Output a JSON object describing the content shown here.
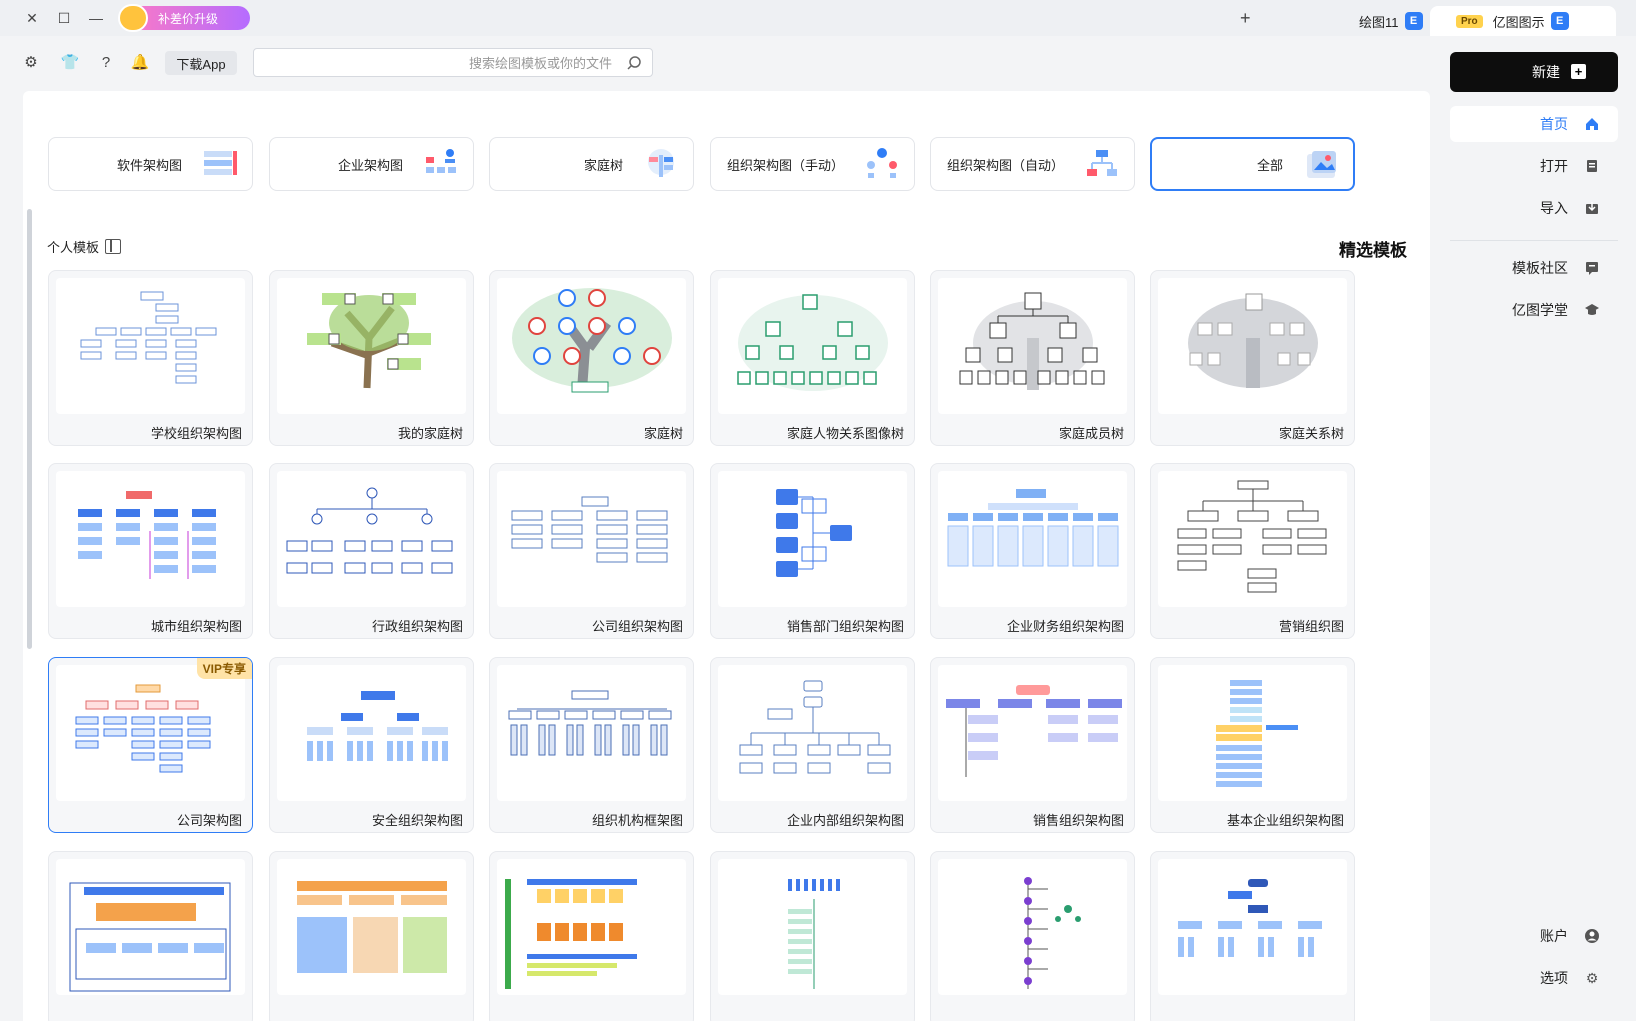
{
  "titlebar": {
    "promo_label": "补差价升级",
    "doc_tab": "绘图11",
    "home_tab": "亿图图示",
    "pro_badge": "Pro",
    "app_badge": "E"
  },
  "toolbar": {
    "download_label": "下载App",
    "search_placeholder": "搜索绘图模板或你的文件"
  },
  "categories": [
    {
      "label": "全部",
      "active": true
    },
    {
      "label": "组织架构图（自动）"
    },
    {
      "label": "组织架构图（手动）"
    },
    {
      "label": "家庭树"
    },
    {
      "label": "企业架构图"
    },
    {
      "label": "软件架构图"
    }
  ],
  "section": {
    "title": "精选模板",
    "personal_label": "个人模板"
  },
  "templates": [
    [
      "家庭关系树",
      "家庭成员树",
      "家庭人物关系图像树",
      "家庭树",
      "我的家庭树",
      "学校组织架构图"
    ],
    [
      "营销组织图",
      "企业财务组织架构图",
      "销售部门组织架构图",
      "公司组织架构图",
      "行政组织架构图",
      "城市组织架构图"
    ],
    [
      "基本企业组织架构图",
      "销售组织架构图",
      "企业内部组织架构图",
      "组织机构框架图",
      "安全组织架构图",
      "公司架构图"
    ],
    [
      "",
      "",
      "",
      "",
      "",
      ""
    ]
  ],
  "vip_badge": "VIP专享",
  "sidebar": {
    "new_label": "新建",
    "nav": [
      {
        "label": "首页",
        "icon": "home-icon",
        "active": true
      },
      {
        "label": "打开",
        "icon": "open-icon"
      },
      {
        "label": "导入",
        "icon": "import-icon"
      }
    ],
    "nav2": [
      {
        "label": "模板社区",
        "icon": "community-icon"
      },
      {
        "label": "亿图学堂",
        "icon": "academy-icon"
      }
    ],
    "bottom": [
      {
        "label": "账户",
        "icon": "account-icon"
      },
      {
        "label": "选项",
        "icon": "settings-icon"
      }
    ]
  },
  "colors": {
    "accent": "#2f7df6",
    "new_button": "#0d0d0d"
  }
}
